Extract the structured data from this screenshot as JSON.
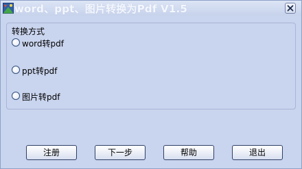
{
  "window": {
    "title": "word、ppt、图片转换为Pdf V1.5",
    "icon": "app-icon",
    "close_icon": "close-icon"
  },
  "group": {
    "label": "转换方式",
    "options": [
      {
        "label": "word转pdf",
        "selected": false
      },
      {
        "label": "ppt转pdf",
        "selected": false
      },
      {
        "label": "图片转pdf",
        "selected": false
      }
    ]
  },
  "buttons": {
    "register": "注册",
    "next": "下一步",
    "help": "帮助",
    "exit": "退出"
  },
  "colors": {
    "background": "#c9d4ee",
    "title_text": "#f4f7fd",
    "border": "#2d3f66"
  }
}
